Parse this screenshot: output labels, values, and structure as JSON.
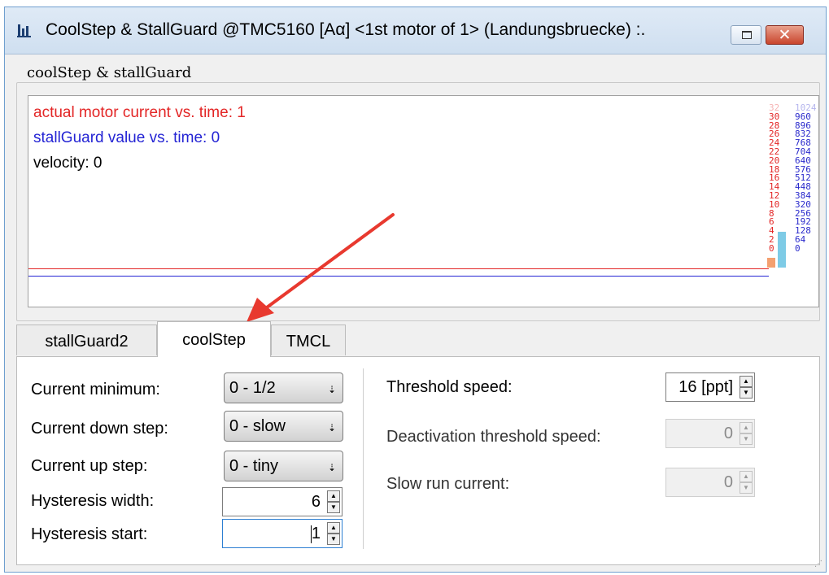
{
  "window": {
    "title": "CoolStep & StallGuard @TMC5160 [Aα] <1st motor of 1> (Landungsbruecke) :.",
    "close_glyph": "✕"
  },
  "group": {
    "title": "coolStep & stallGuard"
  },
  "graph": {
    "labels": {
      "current": "actual motor current vs. time: 1",
      "stallguard": "stallGuard value vs. time: 0",
      "velocity": "velocity: 0"
    },
    "left_scale": [
      "32",
      "30",
      "28",
      "26",
      "24",
      "22",
      "20",
      "18",
      "16",
      "14",
      "12",
      "10",
      "8",
      "6",
      "4",
      "2",
      "0"
    ],
    "right_scale": [
      "1024",
      "960",
      "896",
      "832",
      "768",
      "704",
      "640",
      "576",
      "512",
      "448",
      "384",
      "320",
      "256",
      "192",
      "128",
      "64",
      "0"
    ],
    "bars": {
      "current_level": 1,
      "stallguard_level": 256
    },
    "colors": {
      "current": "#e32626",
      "stallguard": "#2424d4",
      "velocity": "#000000",
      "bar_current": "#f4a070",
      "bar_stallguard": "#7ecbe6"
    }
  },
  "tabs": [
    {
      "label": "stallGuard2",
      "active": false
    },
    {
      "label": "coolStep",
      "active": true
    },
    {
      "label": "TMCL",
      "active": false
    }
  ],
  "coolstep": {
    "current_min": {
      "label": "Current minimum:",
      "value": "0 - 1/2"
    },
    "current_down": {
      "label": "Current down step:",
      "value": "0 - slow"
    },
    "current_up": {
      "label": "Current up step:",
      "value": "0 - tiny"
    },
    "hyst_width": {
      "label": "Hysteresis width:",
      "value": "6"
    },
    "hyst_start": {
      "label": "Hysteresis start:",
      "value": "1"
    },
    "threshold_speed": {
      "label": "Threshold speed:",
      "value": "16 [ppt]"
    },
    "deactivation_speed": {
      "label": "Deactivation threshold speed:",
      "value": "0"
    },
    "slow_run_current": {
      "label": "Slow run current:",
      "value": "0"
    }
  },
  "annotation": {
    "arrow_color": "#e8392f"
  },
  "icons": {
    "app": "bar-chart-icon",
    "dropdown": "small-down-arrow-icon",
    "spin_up": "triangle-up-icon",
    "spin_down": "triangle-down-icon"
  }
}
